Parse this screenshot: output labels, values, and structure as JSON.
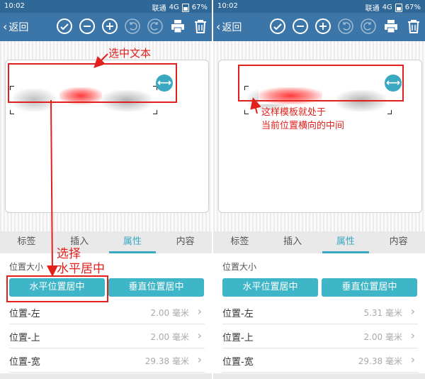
{
  "status_bar": {
    "time": "10:02",
    "carrier": "联通",
    "network": "4G",
    "battery": "67%"
  },
  "toolbar": {
    "back_label": "返回",
    "icons": [
      "check-circle-icon",
      "minus-circle-icon",
      "plus-circle-icon",
      "undo-icon",
      "redo-icon",
      "print-icon",
      "trash-icon"
    ]
  },
  "tabs": [
    "标签",
    "插入",
    "属性",
    "内容"
  ],
  "active_tab": "属性",
  "properties": {
    "section_label": "位置大小",
    "buttons": {
      "h_center": "水平位置居中",
      "v_center": "垂直位置居中"
    },
    "unit": "毫米",
    "rows_labels": [
      "位置-左",
      "位置-上",
      "位置-宽"
    ]
  },
  "panels": {
    "left": {
      "values": [
        "2.00",
        "2.00",
        "29.38"
      ]
    },
    "right": {
      "values": [
        "5.31",
        "2.00",
        "29.38"
      ]
    }
  },
  "annotations": {
    "select_text": "选中文本",
    "choose_line1": "选择",
    "choose_line2": "水平居中",
    "result_line1": "这样模板就处于",
    "result_line2": "当前位置横向的中间",
    "color": "#e2201c"
  },
  "colors": {
    "toolbar": "#3c76a8",
    "status": "#2f6797",
    "accent": "#3aa8c1",
    "button": "#3fb6c8"
  }
}
